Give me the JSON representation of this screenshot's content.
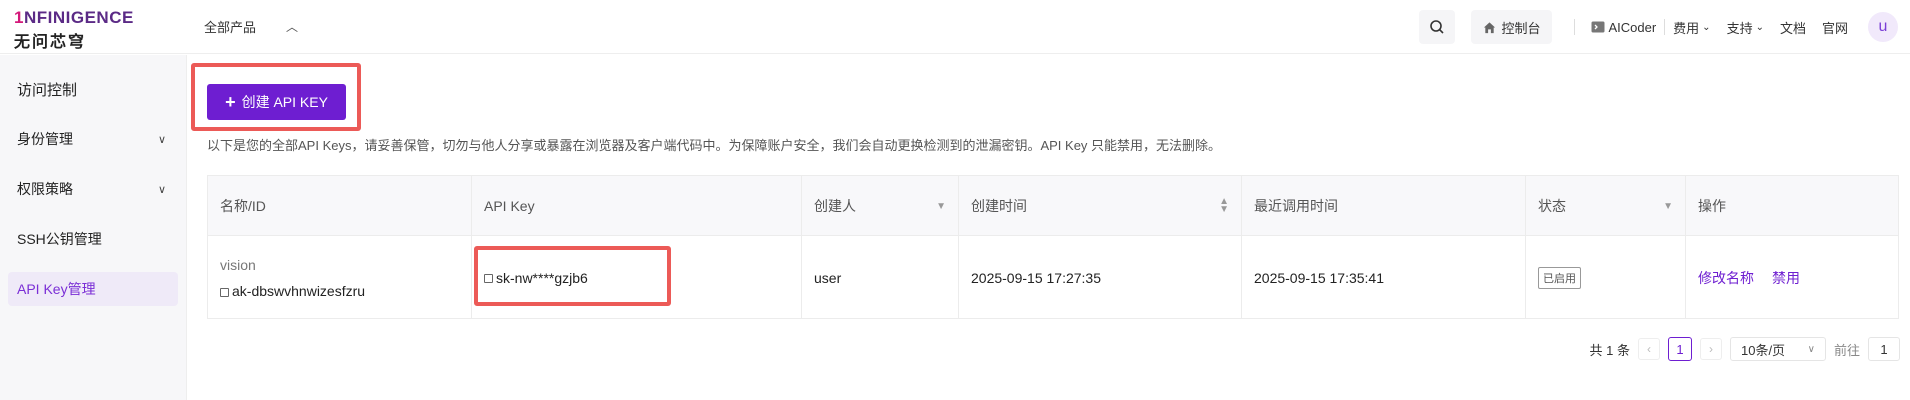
{
  "logo": {
    "line1_prefix": "1",
    "line1_rest": "NFINIGENCE",
    "line2": "无问芯穹"
  },
  "header": {
    "products_label": "全部产品",
    "console_label": "控制台",
    "aicoder_label": "AICoder",
    "cost_label": "费用",
    "support_label": "支持",
    "docs_label": "文档",
    "site_label": "官网",
    "avatar_letter": "u"
  },
  "sidebar": {
    "title": "访问控制",
    "items": [
      {
        "label": "身份管理",
        "expandable": true
      },
      {
        "label": "权限策略",
        "expandable": true
      },
      {
        "label": "SSH公钥管理",
        "expandable": false
      },
      {
        "label": "API Key管理",
        "expandable": false,
        "active": true
      }
    ]
  },
  "main": {
    "create_button": "创建 API KEY",
    "hint": "以下是您的全部API Keys，请妥善保管，切勿与他人分享或暴露在浏览器及客户端代码中。为保障账户安全，我们会自动更换检测到的泄漏密钥。API Key 只能禁用，无法删除。"
  },
  "table": {
    "columns": [
      "名称/ID",
      "API Key",
      "创建人",
      "创建时间",
      "最近调用时间",
      "状态",
      "操作"
    ],
    "rows": [
      {
        "name": "vision",
        "id": "ak-dbswvhnwizesfzru",
        "api_key": "sk-nw****gzjb6",
        "creator": "user",
        "created": "2025-09-15 17:27:35",
        "last_called": "2025-09-15 17:35:41",
        "status": "已启用",
        "actions": [
          "修改名称",
          "禁用"
        ]
      }
    ]
  },
  "pagination": {
    "total": "共 1 条",
    "current_page": "1",
    "page_size": "10条/页",
    "jump_label": "前往",
    "jump_value": "1"
  },
  "colors": {
    "accent": "#6e1ed1",
    "highlight": "#ec5a57"
  }
}
